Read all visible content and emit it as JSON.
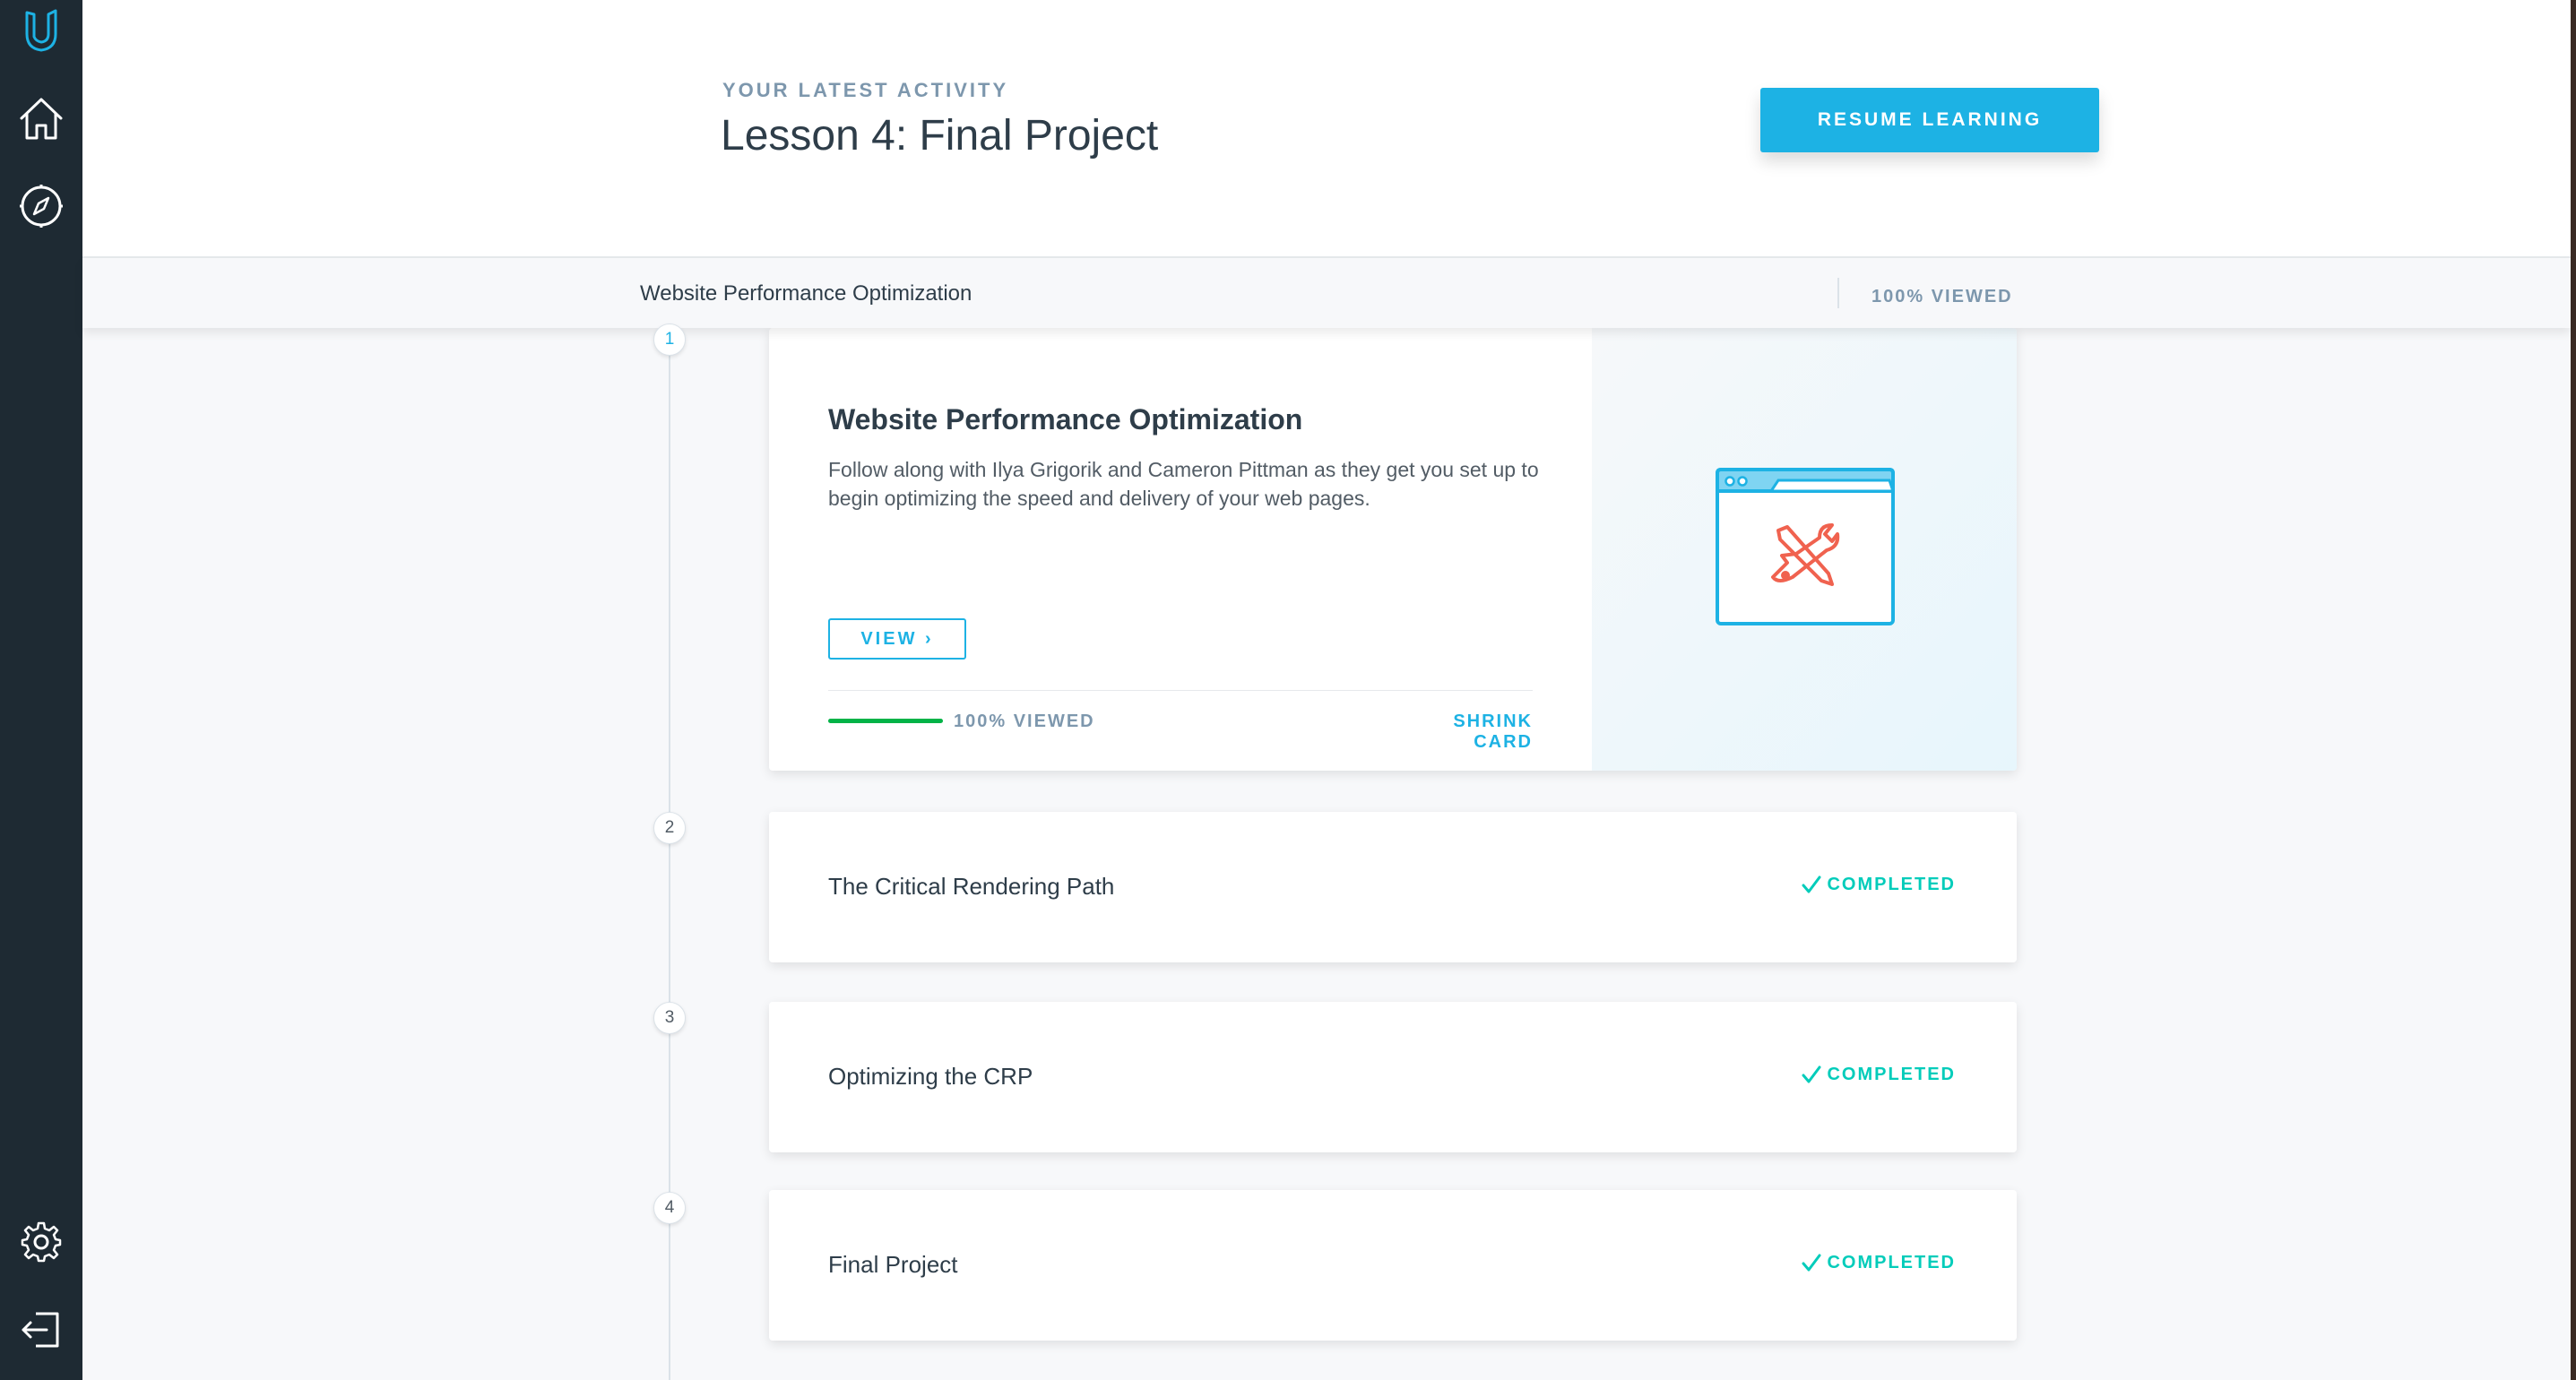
{
  "sidebar": {
    "logo_icon": "udacity-logo-icon",
    "items": [
      {
        "name": "home-icon"
      },
      {
        "name": "compass-icon"
      }
    ],
    "bottom_items": [
      {
        "name": "gear-icon"
      },
      {
        "name": "logout-icon"
      }
    ]
  },
  "header": {
    "activity_label": "YOUR LATEST ACTIVITY",
    "lesson_title": "Lesson 4: Final Project",
    "resume_button": "RESUME LEARNING"
  },
  "course_bar": {
    "title": "Website Performance Optimization",
    "viewed": "100% VIEWED"
  },
  "lessons": [
    {
      "number": "1",
      "title": "Website Performance Optimization",
      "description": "Follow along with Ilya Grigorik and Cameron Pittman as they get you set up to begin optimizing the speed and delivery of your web pages.",
      "view_label": "VIEW ›",
      "progress": 1.0,
      "progress_label": "100% VIEWED",
      "shrink_label": "SHRINK CARD",
      "illustration_icon": "browser-tools-icon"
    },
    {
      "number": "2",
      "title": "The Critical Rendering Path",
      "status": "COMPLETED"
    },
    {
      "number": "3",
      "title": "Optimizing the CRP",
      "status": "COMPLETED"
    },
    {
      "number": "4",
      "title": "Final Project",
      "status": "COMPLETED"
    }
  ],
  "colors": {
    "accent": "#1db2e4",
    "sidebar": "#1e2a33",
    "completed": "#02ccba",
    "progress": "#02b347",
    "illustration_tools": "#f0624f"
  }
}
